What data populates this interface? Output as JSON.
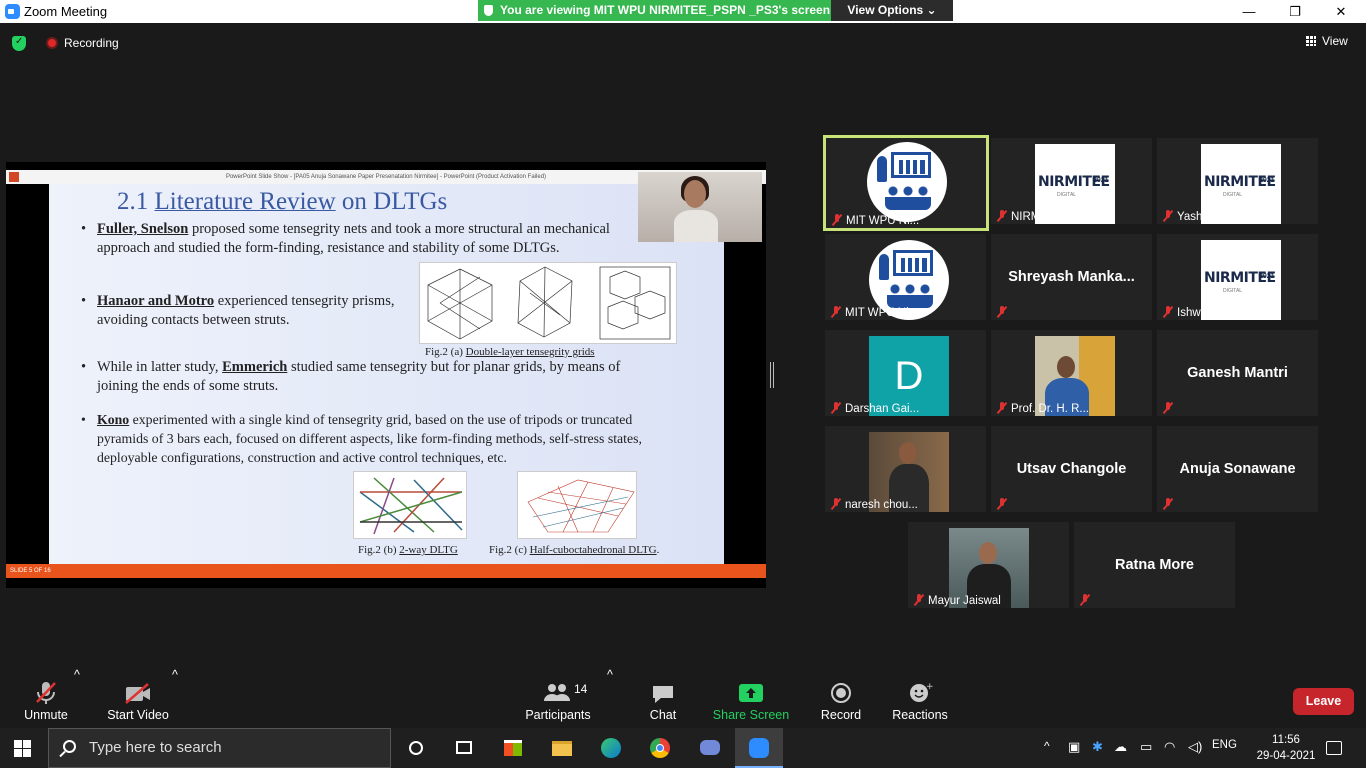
{
  "window": {
    "title": "Zoom Meeting",
    "minimize": "—",
    "restore": "❐",
    "close": "✕"
  },
  "banner": {
    "viewing": "You are viewing MIT WPU NIRMITEE_PSPN _PS3's screen",
    "view_options": "View Options ⌄"
  },
  "topbar": {
    "recording": "Recording",
    "view": "View"
  },
  "slide": {
    "app_title": "PowerPoint Slide Show - [PA05 Anuja Sonawane Paper Presenatation Nirmitee] - PowerPoint (Product Activation Failed)",
    "heading_number": "2.1",
    "heading_underlined": "Literature Review",
    "heading_rest": "on DLTGs",
    "bullets": [
      {
        "name": "Fuller, Snelson",
        "text": " proposed some tensegrity nets and took a more structural an mechanical approach and studied the form-finding, resistance and stability of some DLTGs."
      },
      {
        "name": "Hanaor and Motro",
        "text": " experienced tensegrity prisms, avoiding contacts between struts."
      },
      {
        "prefix": "While in latter study, ",
        "name": "Emmerich",
        "text": " studied same tensegrity but for planar grids, by means of joining the ends of some struts."
      },
      {
        "name": "Kono",
        "text": " experimented with a single kind of tensegrity grid, based on the use of tripods or truncated pyramids of 3 bars each, focused on different aspects, like form-finding methods, self-stress states, deployable configurations, construction and active control techniques, etc."
      }
    ],
    "fig_a_prefix": "Fig.2 (a) ",
    "fig_a_title": "Double-layer tensegrity grids",
    "fig_b_prefix": "Fig.2 (b) ",
    "fig_b_title": "2-way DLTG",
    "fig_c_prefix": "Fig.2 (c) ",
    "fig_c_title": "Half-cuboctahedronal DLTG",
    "fig_c_suffix": ".",
    "slide_counter": "SLIDE 5 OF 16"
  },
  "participants": [
    {
      "name": "MIT WPU Ni...",
      "type": "presentation",
      "active": true
    },
    {
      "name": "NIRMITEE Ins...",
      "type": "nirmitee"
    },
    {
      "name": "Yash Nandode",
      "type": "nirmitee"
    },
    {
      "name": "MIT WPU Ni...",
      "type": "presentation"
    },
    {
      "name": "Shreyash  Manka...",
      "type": "name-only"
    },
    {
      "name": "Ishwari Patil",
      "type": "nirmitee"
    },
    {
      "name": "Darshan Gai...",
      "type": "letter",
      "letter": "D"
    },
    {
      "name": "Prof. Dr. H. R...",
      "type": "photo"
    },
    {
      "name": "Ganesh Mantri",
      "type": "name-only"
    },
    {
      "name": "naresh chou...",
      "type": "photo"
    },
    {
      "name": "Utsav Changole",
      "type": "name-only"
    },
    {
      "name": "Anuja Sonawane",
      "type": "name-only"
    },
    {
      "name": "Mayur Jaiswal",
      "type": "photo"
    },
    {
      "name": "Ratna More",
      "type": "name-only"
    }
  ],
  "nirmitee_logo": {
    "text": "NIRMITEE",
    "year": "2021",
    "sub": "DIGITAL"
  },
  "toolbar": {
    "unmute": "Unmute",
    "start_video": "Start Video",
    "participants": "Participants",
    "participants_count": "14",
    "chat": "Chat",
    "share_screen": "Share Screen",
    "record": "Record",
    "reactions": "Reactions",
    "leave": "Leave"
  },
  "taskbar": {
    "search_placeholder": "Type here to search",
    "language": "ENG",
    "time": "11:56",
    "date": "29-04-2021"
  },
  "colors": {
    "active_speaker": "#c7e37a",
    "share_green": "#23d160",
    "leave_red": "#c6262b",
    "banner_green": "#36b74f"
  }
}
